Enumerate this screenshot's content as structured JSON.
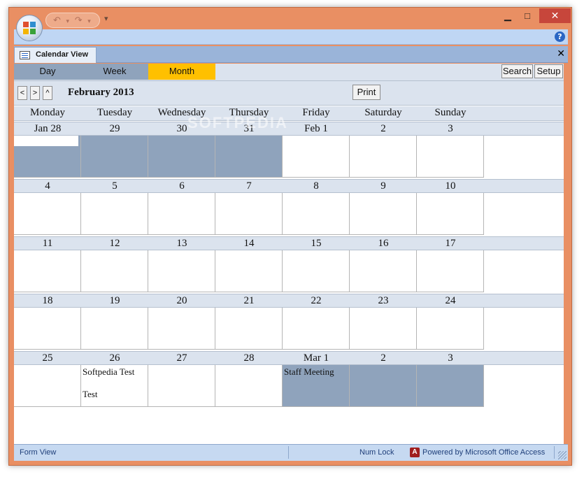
{
  "window": {
    "qat_undo": "↶",
    "qat_redo": "↷",
    "qat_dropdown": "▾",
    "minimize": "▁",
    "maximize": "□",
    "close": "✕",
    "help": "?",
    "frame_color": "#e98f63"
  },
  "doc_tab": {
    "title": "Calendar View",
    "close": "✕"
  },
  "view_tabs": {
    "day": "Day",
    "week": "Week",
    "month": "Month",
    "active": "Month",
    "active_color": "#ffc000",
    "inactive_color": "#8fa3bc"
  },
  "toolbar": {
    "search": "Search",
    "setup": "Setup",
    "prev": "<",
    "next": ">",
    "today": "^",
    "month_title": "February 2013",
    "print": "Print"
  },
  "day_names": [
    "Monday",
    "Tuesday",
    "Wednesday",
    "Thursday",
    "Friday",
    "Saturday",
    "Sunday"
  ],
  "weeks": [
    {
      "dates": [
        "Jan 28",
        "29",
        "30",
        "31",
        "Feb 1",
        "2",
        "3"
      ],
      "shaded": [
        true,
        true,
        true,
        true,
        false,
        false,
        false
      ],
      "events": [
        [],
        [],
        [],
        [],
        [],
        [],
        []
      ]
    },
    {
      "dates": [
        "4",
        "5",
        "6",
        "7",
        "8",
        "9",
        "10"
      ],
      "shaded": [
        false,
        false,
        false,
        false,
        false,
        false,
        false
      ],
      "events": [
        [],
        [],
        [],
        [],
        [],
        [],
        []
      ]
    },
    {
      "dates": [
        "11",
        "12",
        "13",
        "14",
        "15",
        "16",
        "17"
      ],
      "shaded": [
        false,
        false,
        false,
        false,
        false,
        false,
        false
      ],
      "events": [
        [],
        [],
        [],
        [],
        [],
        [],
        []
      ]
    },
    {
      "dates": [
        "18",
        "19",
        "20",
        "21",
        "22",
        "23",
        "24"
      ],
      "shaded": [
        false,
        false,
        false,
        false,
        false,
        false,
        false
      ],
      "events": [
        [],
        [],
        [],
        [],
        [],
        [],
        []
      ]
    },
    {
      "dates": [
        "25",
        "26",
        "27",
        "28",
        "Mar 1",
        "2",
        "3"
      ],
      "shaded": [
        false,
        false,
        false,
        false,
        true,
        true,
        true
      ],
      "events": [
        [],
        [
          "Softpedia Test",
          "Test"
        ],
        [],
        [],
        [
          "Staff Meeting"
        ],
        [],
        []
      ]
    }
  ],
  "watermark": "SOFTPEDIA",
  "statusbar": {
    "view": "Form View",
    "num_lock": "Num Lock",
    "powered": "Powered by Microsoft Office Access"
  }
}
